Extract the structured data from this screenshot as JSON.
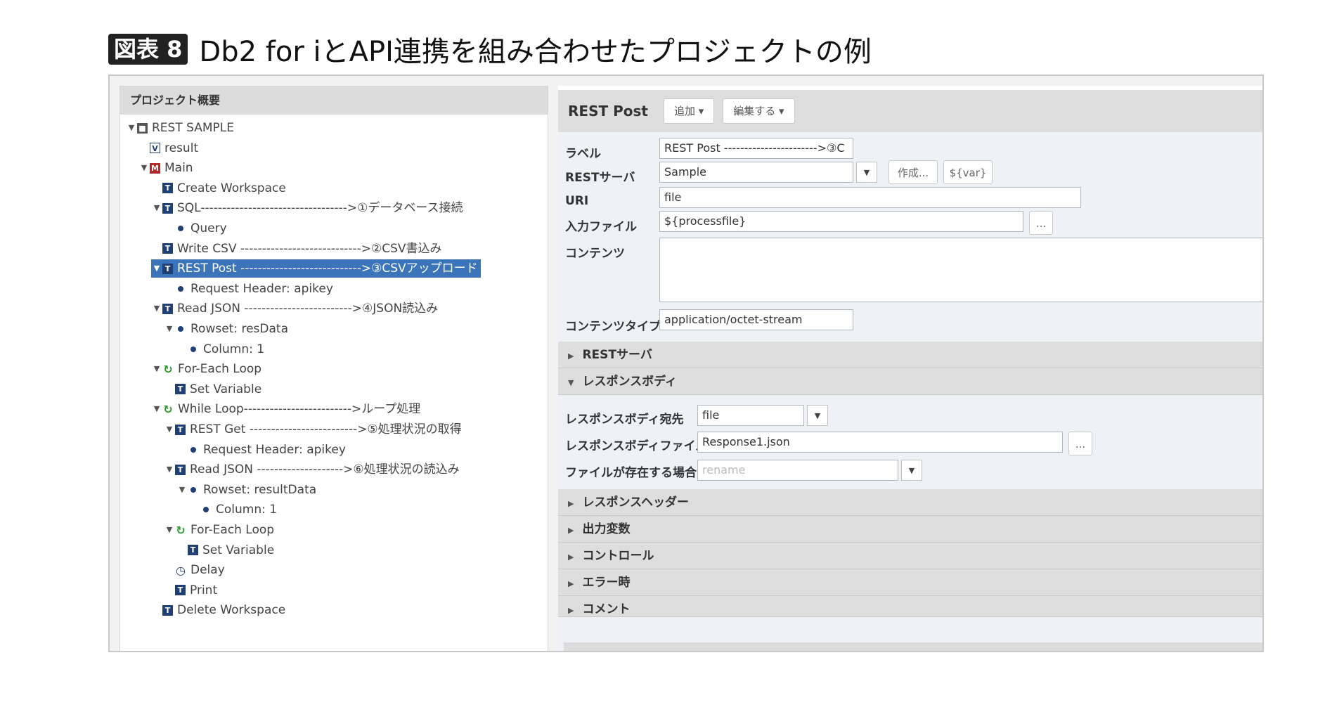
{
  "caption": {
    "badge": "図表 8",
    "title": "Db2 for iとAPI連携を組み合わせたプロジェクトの例"
  },
  "left": {
    "header": "プロジェクト概要",
    "tree": [
      {
        "label": "REST SAMPLE",
        "icon": "disk",
        "toggle": "▼",
        "indent": 0
      },
      {
        "label": "result",
        "icon": "v",
        "toggle": "",
        "indent": 1
      },
      {
        "label": "Main",
        "icon": "m",
        "toggle": "▼",
        "indent": 1
      },
      {
        "label": "Create Workspace",
        "icon": "t",
        "toggle": "",
        "indent": 2
      },
      {
        "label": "SQL---------------------------------->①データベース接続",
        "icon": "t",
        "toggle": "▼",
        "indent": 2
      },
      {
        "label": "Query",
        "icon": "dot",
        "toggle": "",
        "indent": 3
      },
      {
        "label": "Write CSV ---------------------------->②CSV書込み",
        "icon": "t",
        "toggle": "",
        "indent": 2
      },
      {
        "label": "REST Post ---------------------------->③CSVアップロード",
        "icon": "t",
        "toggle": "▼",
        "indent": 2,
        "selected": true
      },
      {
        "label": "Request Header: apikey",
        "icon": "dot",
        "toggle": "",
        "indent": 3
      },
      {
        "label": "Read JSON ------------------------->④JSON読込み",
        "icon": "t",
        "toggle": "▼",
        "indent": 2
      },
      {
        "label": "Rowset: resData",
        "icon": "dot",
        "toggle": "▼",
        "indent": 3
      },
      {
        "label": "Column: 1",
        "icon": "dot",
        "toggle": "",
        "indent": 4
      },
      {
        "label": "For-Each Loop",
        "icon": "loop",
        "toggle": "▼",
        "indent": 2
      },
      {
        "label": "Set Variable",
        "icon": "t",
        "toggle": "",
        "indent": 3
      },
      {
        "label": "While Loop------------------------->ループ処理",
        "icon": "loop",
        "toggle": "▼",
        "indent": 2
      },
      {
        "label": "REST Get ------------------------->⑤処理状況の取得",
        "icon": "t",
        "toggle": "▼",
        "indent": 3
      },
      {
        "label": "Request Header: apikey",
        "icon": "dot",
        "toggle": "",
        "indent": 4
      },
      {
        "label": "Read JSON -------------------->⑥処理状況の読込み",
        "icon": "t",
        "toggle": "▼",
        "indent": 3
      },
      {
        "label": "Rowset: resultData",
        "icon": "dot",
        "toggle": "▼",
        "indent": 4
      },
      {
        "label": "Column: 1",
        "icon": "dot",
        "toggle": "",
        "indent": 5
      },
      {
        "label": "For-Each Loop",
        "icon": "loop",
        "toggle": "▼",
        "indent": 3
      },
      {
        "label": "Set Variable",
        "icon": "t",
        "toggle": "",
        "indent": 4
      },
      {
        "label": "Delay",
        "icon": "clock",
        "toggle": "",
        "indent": 3
      },
      {
        "label": "Print",
        "icon": "t",
        "toggle": "",
        "indent": 3
      },
      {
        "label": "Delete Workspace",
        "icon": "t",
        "toggle": "",
        "indent": 2
      }
    ]
  },
  "right": {
    "title": "REST Post",
    "add_button": "追加 ▾",
    "edit_button": "編集する ▾",
    "form": {
      "label_label": "ラベル",
      "label_value": "REST Post ----------------------->③C",
      "server_label": "RESTサーバ",
      "server_value": "Sample",
      "create_button": "作成...",
      "var_button": "${var}",
      "uri_label": "URI",
      "uri_value": "file",
      "input_label": "入力ファイル",
      "input_value": "${processfile}",
      "browse": "...",
      "content_label": "コンテンツ",
      "content_value": "",
      "ctype_label": "コンテンツタイプ",
      "ctype_value": "application/octet-stream"
    },
    "sections": {
      "rest_server": "RESTサーバ",
      "response_body": "レスポンスボディ",
      "response_header": "レスポンスヘッダー",
      "output_vars": "出力変数",
      "control": "コントロール",
      "on_error": "エラー時",
      "comment": "コメント"
    },
    "response": {
      "dest_label": "レスポンスボディ宛先",
      "dest_value": "file",
      "file_label": "レスポンスボディファイル",
      "file_value": "Response1.json",
      "browse": "...",
      "exists_label": "ファイルが存在する場合",
      "exists_placeholder": "rename"
    }
  }
}
